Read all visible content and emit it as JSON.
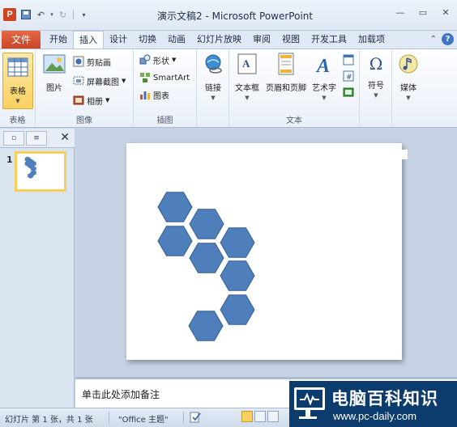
{
  "app": {
    "logo_letter": "P",
    "window_title": "演示文稿2 - Microsoft PowerPoint",
    "window_buttons": [
      "—",
      "▭",
      "✕"
    ]
  },
  "ribbon_tabs": {
    "file": "文件",
    "items": [
      "开始",
      "插入",
      "设计",
      "切换",
      "动画",
      "幻灯片放映",
      "审阅",
      "视图",
      "开发工具",
      "加载项"
    ],
    "active": "插入"
  },
  "ribbon": {
    "groups": {
      "table": {
        "label": "表格",
        "table_button": "表格"
      },
      "images": {
        "label": "图像",
        "picture": "图片",
        "clipart": "剪贴画",
        "screenshot": "屏幕截图",
        "album": "相册"
      },
      "illustrations": {
        "label": "插图",
        "shapes": "形状",
        "smartart": "SmartArt",
        "chart": "图表"
      },
      "links": {
        "label": "",
        "link": "链接"
      },
      "text": {
        "label": "文本",
        "textbox": "文本框",
        "header_footer": "页眉和页脚",
        "wordart": "艺术字"
      },
      "symbols": {
        "label": "",
        "symbol": "符号"
      },
      "media": {
        "label": "",
        "media": "媒体"
      }
    }
  },
  "slide_panel": {
    "slide_number": "1",
    "close": "✕"
  },
  "notes": {
    "placeholder": "单击此处添加备注"
  },
  "status": {
    "slide_info": "幻灯片 第 1 张，共 1 张",
    "theme": "\"Office 主题\""
  },
  "watermark": {
    "title": "电脑百科知识",
    "url": "www.pc-daily.com"
  },
  "colors": {
    "hex_fill": "#4f7fba",
    "file_tab": "#d35130",
    "watermark_bg": "#0c3c6e"
  }
}
